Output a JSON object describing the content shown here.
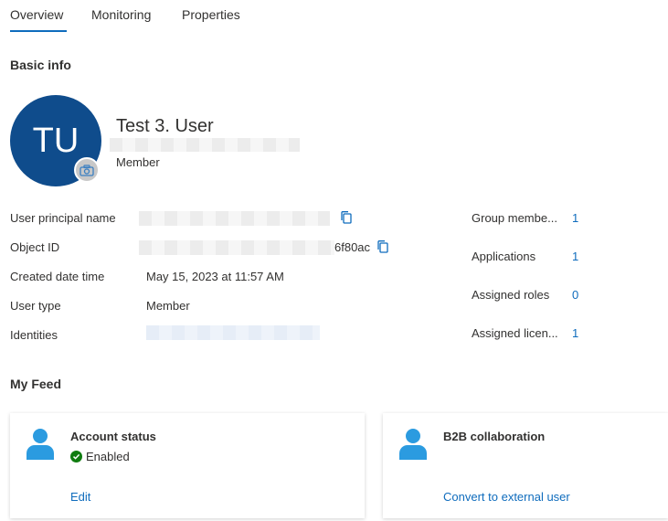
{
  "tabs": [
    {
      "label": "Overview",
      "active": true
    },
    {
      "label": "Monitoring",
      "active": false
    },
    {
      "label": "Properties",
      "active": false
    }
  ],
  "basic_info": {
    "title": "Basic info",
    "avatar_initials": "TU",
    "display_name": "Test 3. User",
    "user_type_sub": "Member"
  },
  "properties": [
    {
      "label": "User principal name",
      "value": ""
    },
    {
      "label": "Object ID",
      "value": "6f80ac"
    },
    {
      "label": "Created date time",
      "value": "May 15, 2023 at 11:57 AM"
    },
    {
      "label": "User type",
      "value": "Member"
    },
    {
      "label": "Identities",
      "value": ""
    }
  ],
  "stats": [
    {
      "label": "Group membe...",
      "value": "1"
    },
    {
      "label": "Applications",
      "value": "1"
    },
    {
      "label": "Assigned roles",
      "value": "0"
    },
    {
      "label": "Assigned licen...",
      "value": "1"
    }
  ],
  "feed": {
    "title": "My Feed",
    "cards": [
      {
        "title": "Account status",
        "status": "Enabled",
        "link": "Edit"
      },
      {
        "title": "B2B collaboration",
        "link": "Convert to external user"
      }
    ]
  },
  "colors": {
    "accent": "#0f6cbd",
    "avatar_bg": "#0f4c8c",
    "person_icon": "#2b9be0",
    "enabled_green": "#107c10"
  }
}
